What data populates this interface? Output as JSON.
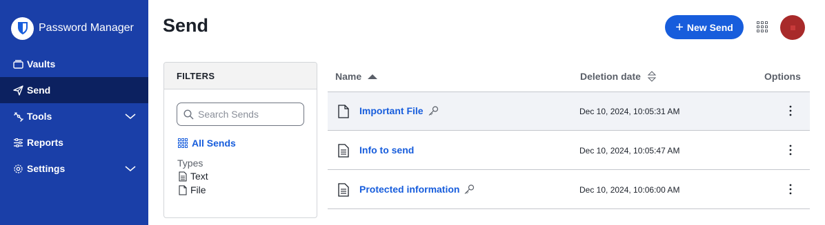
{
  "brand": {
    "name": "Password Manager"
  },
  "sidebar": {
    "items": [
      {
        "label": "Vaults",
        "icon": "vault-icon"
      },
      {
        "label": "Send",
        "icon": "send-icon",
        "active": true
      },
      {
        "label": "Tools",
        "icon": "wrench-icon",
        "expandable": true
      },
      {
        "label": "Reports",
        "icon": "sliders-icon"
      },
      {
        "label": "Settings",
        "icon": "gear-icon",
        "expandable": true
      }
    ]
  },
  "header": {
    "title": "Send",
    "new_send_label": "New Send",
    "apps_icon": "grid-icon"
  },
  "filters": {
    "title": "FILTERS",
    "search_placeholder": "Search Sends",
    "all_sends_label": "All Sends",
    "types_label": "Types",
    "types": [
      {
        "label": "Text",
        "icon": "text-file-icon"
      },
      {
        "label": "File",
        "icon": "file-icon"
      }
    ]
  },
  "table": {
    "columns": {
      "name": "Name",
      "deletion_date": "Deletion date",
      "options": "Options"
    },
    "rows": [
      {
        "name": "Important File",
        "type": "file",
        "protected": true,
        "deletion_date": "Dec 10, 2024, 10:05:31 AM"
      },
      {
        "name": "Info to send",
        "type": "text",
        "protected": false,
        "deletion_date": "Dec 10, 2024, 10:05:47 AM"
      },
      {
        "name": "Protected information",
        "type": "text",
        "protected": true,
        "deletion_date": "Dec 10, 2024, 10:06:00 AM"
      }
    ]
  },
  "colors": {
    "sidebar": "#1a3fa8",
    "sidebar_active": "#0c2160",
    "accent": "#175ddc",
    "avatar": "#a82a2a"
  }
}
